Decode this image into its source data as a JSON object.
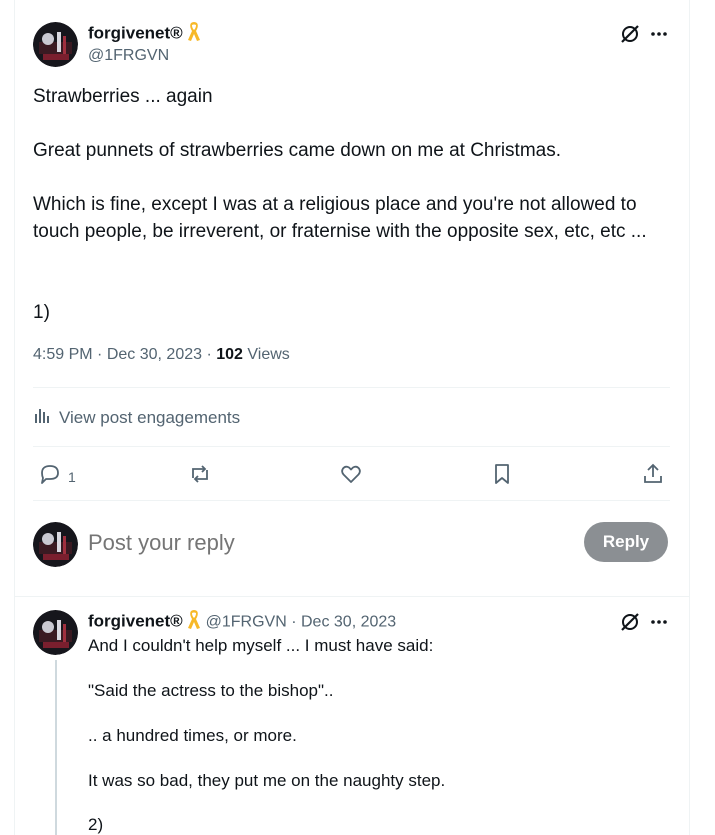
{
  "main_tweet": {
    "author_name": "forgivenet®",
    "author_handle": "@1FRGVN",
    "paragraphs": [
      "Strawberries ... again",
      "Great punnets of strawberries came down on me at Christmas.",
      "Which is fine, except I was at a religious place and you're not allowed to touch people, be irreverent, or fraternise with the opposite sex, etc, etc ...",
      "1)"
    ],
    "time": "4:59 PM",
    "date": "Dec 30, 2023",
    "views_count": "102",
    "views_label": "Views",
    "engagements_label": "View post engagements",
    "actions": {
      "reply_count": "1"
    }
  },
  "composer": {
    "placeholder": "Post your reply",
    "reply_button": "Reply"
  },
  "reply_tweet": {
    "author_name": "forgivenet®",
    "author_handle": "@1FRGVN",
    "date": "Dec 30, 2023",
    "paragraphs": [
      "And I couldn't help myself ... I must have said:",
      "\"Said the actress to the bishop\"..",
      ".. a hundred times, or more.",
      "It was so bad, they put me on the naughty step.",
      "2)"
    ]
  },
  "colors": {
    "accent": "#1d9bf0",
    "ribbon": "#f7b928",
    "muted": "#536471",
    "reply_button_bg": "#8b8f93"
  }
}
